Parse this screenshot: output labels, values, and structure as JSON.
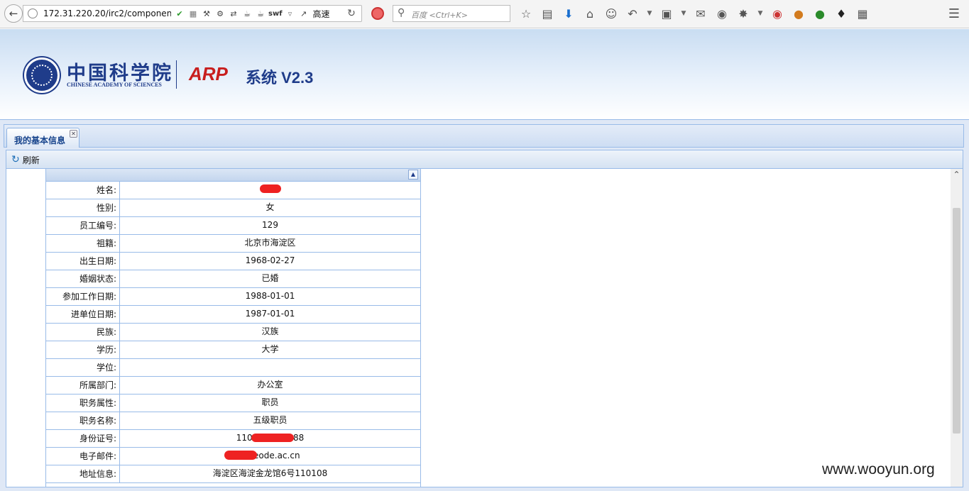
{
  "browser": {
    "url": "172.31.220.20/irc2/componen",
    "url_icons": [
      "shield-check-icon",
      "qr-code-icon",
      "tools-icon",
      "gear-icon",
      "translate-icon",
      "java-icon",
      "java-icon"
    ],
    "swf_label": "swf",
    "speed_label": "高速",
    "search_placeholder": "百度 <Ctrl+K>",
    "toolbar_icons": [
      "bookmark-star-icon",
      "reading-list-icon",
      "download-icon",
      "home-icon",
      "emoji-icon",
      "undo-icon",
      "crop-icon",
      "chat-icon",
      "user-icon",
      "bug-icon",
      "addon-icon",
      "fox-icon",
      "shield-icon",
      "shield-dark-icon",
      "grid-icon"
    ]
  },
  "header": {
    "org_name_cn": "中国科学院",
    "org_name_en": "CHINESE ACADEMY OF SCIENCES",
    "arp_logo": "ARP",
    "system_title": "系统 V2.3"
  },
  "tabs": [
    {
      "label": "我的基本信息",
      "active": true
    }
  ],
  "toolbar": {
    "refresh_label": "刷新"
  },
  "profile": {
    "rows": [
      {
        "label": "姓名:",
        "value": ""
      },
      {
        "label": "性别:",
        "value": "女"
      },
      {
        "label": "员工编号:",
        "value": "129"
      },
      {
        "label": "祖籍:",
        "value": "北京市海淀区"
      },
      {
        "label": "出生日期:",
        "value": "1968-02-27"
      },
      {
        "label": "婚姻状态:",
        "value": "已婚"
      },
      {
        "label": "参加工作日期:",
        "value": "1988-01-01"
      },
      {
        "label": "进单位日期:",
        "value": "1987-01-01"
      },
      {
        "label": "民族:",
        "value": "汉族"
      },
      {
        "label": "学历:",
        "value": "大学"
      },
      {
        "label": "学位:",
        "value": ""
      },
      {
        "label": "所属部门:",
        "value": "办公室"
      },
      {
        "label": "职务属性:",
        "value": "职员"
      },
      {
        "label": "职务名称:",
        "value": "五级职员"
      },
      {
        "label": "身份证号:",
        "value": "110108 270088"
      },
      {
        "label": "电子邮件:",
        "value": "@ceode.ac.cn"
      },
      {
        "label": "地址信息:",
        "value": "海淀区海淀金龙馆6号110108"
      }
    ]
  },
  "colors": {
    "brand_blue": "#1f3c8a",
    "arp_red": "#c81e1e",
    "panel_border": "#99bbe8",
    "redaction": "#ee2222"
  },
  "watermark": "www.wooyun.org"
}
